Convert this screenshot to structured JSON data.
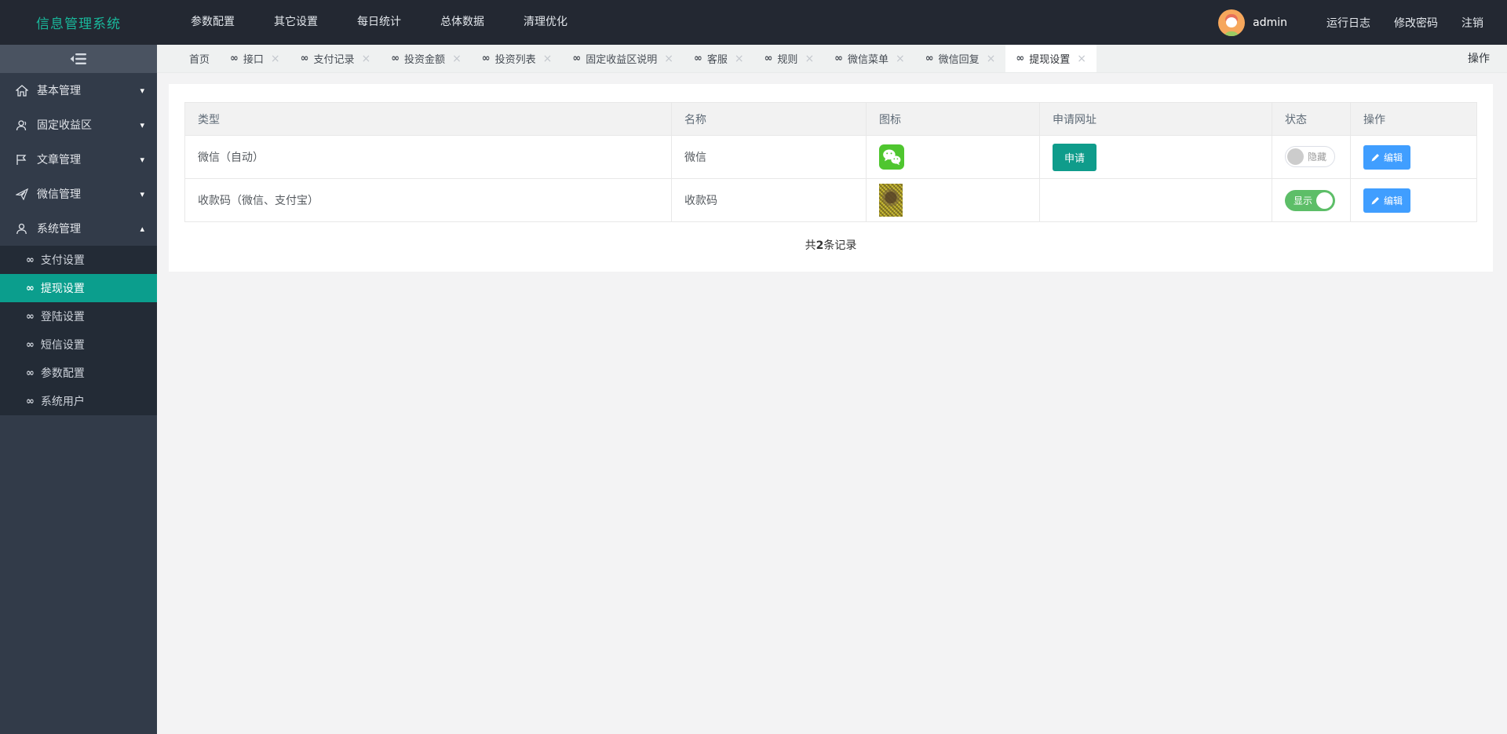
{
  "header": {
    "logo": "信息管理系统",
    "menu": [
      {
        "label": "参数配置"
      },
      {
        "label": "其它设置"
      },
      {
        "label": "每日统计"
      },
      {
        "label": "总体数据"
      },
      {
        "label": "清理优化"
      }
    ],
    "username": "admin",
    "right_menu": [
      {
        "label": "运行日志"
      },
      {
        "label": "修改密码"
      },
      {
        "label": "注销"
      }
    ]
  },
  "sidebar": {
    "items": [
      {
        "label": "基本管理",
        "icon": "home-icon",
        "caret": "▾"
      },
      {
        "label": "固定收益区",
        "icon": "users-icon",
        "caret": "▾"
      },
      {
        "label": "文章管理",
        "icon": "flag-icon",
        "caret": "▾"
      },
      {
        "label": "微信管理",
        "icon": "send-icon",
        "caret": "▾"
      },
      {
        "label": "系统管理",
        "icon": "user-icon",
        "caret": "▴"
      }
    ],
    "submenu": [
      {
        "label": "支付设置",
        "icon": "∞",
        "active": false
      },
      {
        "label": "提现设置",
        "icon": "∞",
        "active": true
      },
      {
        "label": "登陆设置",
        "icon": "∞",
        "active": false
      },
      {
        "label": "短信设置",
        "icon": "∞",
        "active": false
      },
      {
        "label": "参数配置",
        "icon": "∞",
        "active": false
      },
      {
        "label": "系统用户",
        "icon": "∞",
        "active": false
      }
    ]
  },
  "tabbar": {
    "link_glyph": "∞",
    "close_glyph": "×",
    "actions_label": "操作",
    "tabs": [
      {
        "label": "首页"
      },
      {
        "label": "接口"
      },
      {
        "label": "支付记录"
      },
      {
        "label": "投资金额"
      },
      {
        "label": "投资列表"
      },
      {
        "label": "固定收益区说明"
      },
      {
        "label": "客服"
      },
      {
        "label": "规则"
      },
      {
        "label": "微信菜单"
      },
      {
        "label": "微信回复"
      },
      {
        "label": "提现设置"
      }
    ]
  },
  "table": {
    "columns": [
      "类型",
      "名称",
      "图标",
      "申请网址",
      "状态",
      "操作"
    ],
    "rows": [
      {
        "type": "微信（自动）",
        "name": "微信",
        "icon": "wechat-icon",
        "apply_label": "申请",
        "status_label": "隐藏",
        "status_on": false,
        "edit_label": "编辑"
      },
      {
        "type": "收款码（微信、支付宝）",
        "name": "收款码",
        "icon": "qrcode-image",
        "apply_label": "",
        "status_label": "显示",
        "status_on": true,
        "edit_label": "编辑"
      }
    ],
    "footer": {
      "prefix": "共",
      "count": "2",
      "suffix": "条记录"
    }
  },
  "colors": {
    "logo_teal": "#19b79b",
    "sidebar_active_teal": "#0b9e8d",
    "apply_button_teal": "#0f9c8b",
    "edit_button_blue": "#409eff",
    "toggle_on_green": "#5dbe68",
    "wechat_green": "#4fc62f",
    "navbar_dark": "#232832",
    "sidebar_dark": "#323b49"
  }
}
